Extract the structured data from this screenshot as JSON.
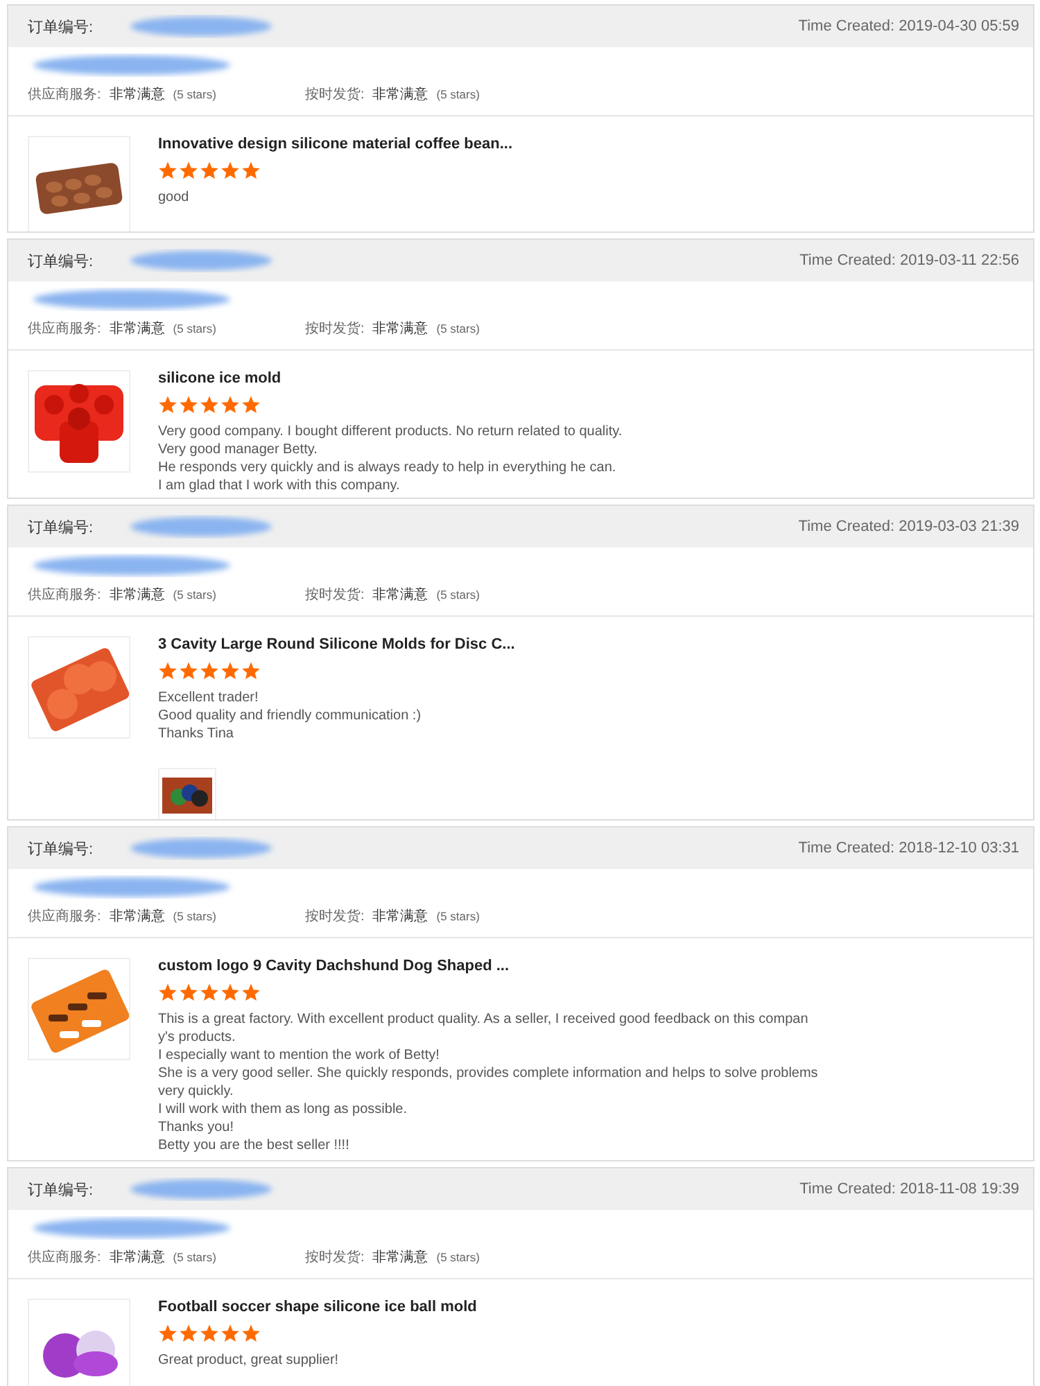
{
  "orders": [
    {
      "order_label": "订单编号:",
      "order_number_redacted": true,
      "time_created": "Time Created: 2019-04-30 05:59",
      "buyer_redacted": true,
      "ratings": [
        {
          "label": "供应商服务:",
          "value": "非常满意",
          "stars_text": "(5 stars)"
        },
        {
          "label": "按时发货:",
          "value": "非常满意",
          "stars_text": "(5 stars)"
        }
      ],
      "product": {
        "image": {
          "kind": "picture"
        },
        "title": "Innovative design silicone material coffee bean...",
        "stars": 5,
        "review": [
          "good"
        ]
      }
    },
    {
      "order_label": "订单编号:",
      "order_number_redacted": true,
      "time_created": "Time Created: 2019-03-11 22:56",
      "buyer_redacted": true,
      "ratings": [
        {
          "label": "供应商服务:",
          "value": "非常满意",
          "stars_text": "(5 stars)"
        },
        {
          "label": "按时发货:",
          "value": "非常满意",
          "stars_text": "(5 stars)"
        }
      ],
      "product": {
        "image": {
          "kind": "picture"
        },
        "title": "silicone ice mold",
        "stars": 5,
        "review": [
          "Very good company. I bought different products. No return related to quality.",
          "Very good manager Betty.",
          "He responds very quickly and is always ready to help in everything he can.",
          "I am glad that I work with this company."
        ]
      }
    },
    {
      "order_label": "订单编号:",
      "order_number_redacted": true,
      "time_created": "Time Created: 2019-03-03 21:39",
      "buyer_redacted": true,
      "ratings": [
        {
          "label": "供应商服务:",
          "value": "非常满意",
          "stars_text": "(5 stars)"
        },
        {
          "label": "按时发货:",
          "value": "非常满意",
          "stars_text": "(5 stars)"
        }
      ],
      "product": {
        "image": {
          "kind": "picture"
        },
        "title": "3 Cavity Large Round Silicone Molds for Disc C...",
        "stars": 5,
        "review": [
          "Excellent trader!",
          "Good quality and friendly communication :)",
          "Thanks Tina"
        ],
        "photos": [
          {
            "kind": "picture"
          }
        ]
      }
    },
    {
      "order_label": "订单编号:",
      "order_number_redacted": true,
      "time_created": "Time Created: 2018-12-10 03:31",
      "buyer_redacted": true,
      "ratings": [
        {
          "label": "供应商服务:",
          "value": "非常满意",
          "stars_text": "(5 stars)"
        },
        {
          "label": "按时发货:",
          "value": "非常满意",
          "stars_text": "(5 stars)"
        }
      ],
      "product": {
        "image": {
          "kind": "picture"
        },
        "title": "custom logo 9 Cavity Dachshund Dog Shaped ...",
        "stars": 5,
        "review": [
          "This is a great factory. With excellent product quality. As a seller, I received good feedback on this compan",
          "y's products.",
          "I especially want to mention the work of Betty!",
          "She is a very good seller. She quickly responds, provides complete information and helps to solve problems",
          "very quickly.",
          "I will work with them as long as possible.",
          "Thanks you!",
          "Betty you are the best seller !!!!"
        ]
      }
    },
    {
      "order_label": "订单编号:",
      "order_number_redacted": true,
      "time_created": "Time Created: 2018-11-08 19:39",
      "buyer_redacted": true,
      "ratings": [
        {
          "label": "供应商服务:",
          "value": "非常满意",
          "stars_text": "(5 stars)"
        },
        {
          "label": "按时发货:",
          "value": "非常满意",
          "stars_text": "(5 stars)"
        }
      ],
      "product": {
        "image": {
          "kind": "picture"
        },
        "title": "Football soccer shape silicone ice ball mold",
        "stars": 5,
        "review": [
          "Great product, great supplier!"
        ]
      }
    }
  ]
}
